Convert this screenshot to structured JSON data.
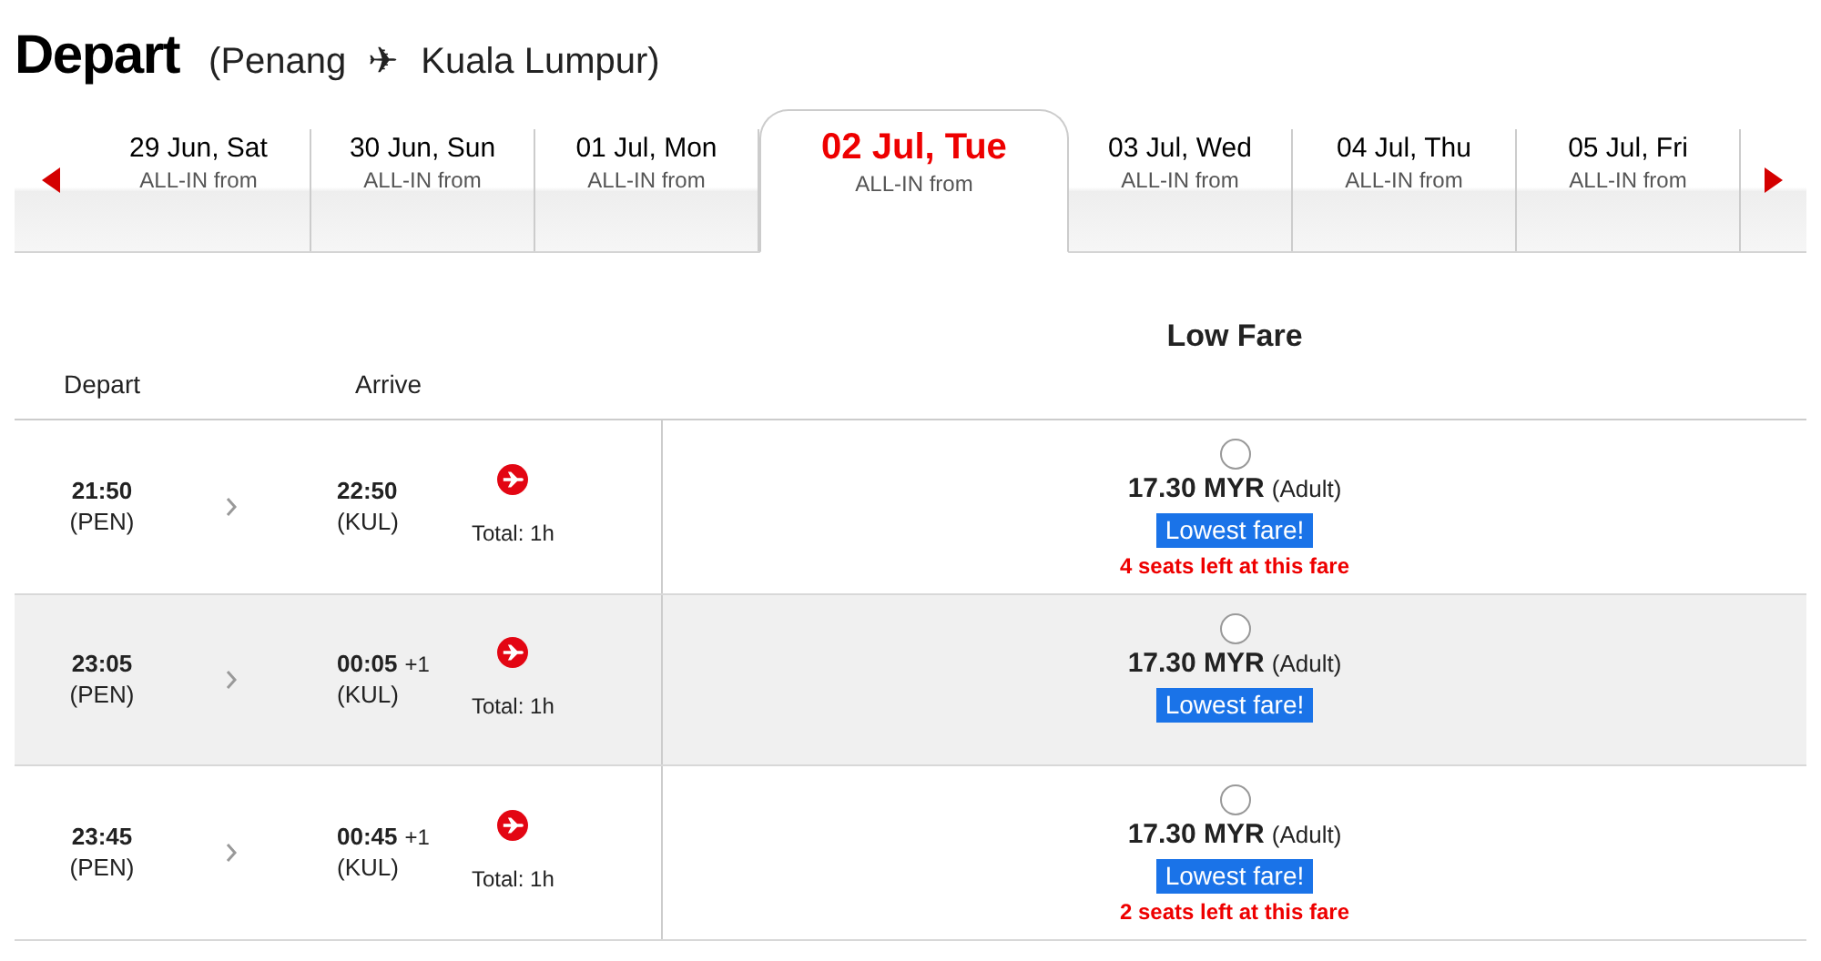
{
  "header": {
    "title": "Depart",
    "origin": "(Penang",
    "arrow": "✈",
    "destination": "Kuala Lumpur)"
  },
  "dates": [
    {
      "date": "29 Jun, Sat",
      "sub": "ALL-IN from",
      "selected": false
    },
    {
      "date": "30 Jun, Sun",
      "sub": "ALL-IN from",
      "selected": false
    },
    {
      "date": "01 Jul, Mon",
      "sub": "ALL-IN from",
      "selected": false
    },
    {
      "date": "02 Jul, Tue",
      "sub": "ALL-IN from",
      "selected": true
    },
    {
      "date": "03 Jul, Wed",
      "sub": "ALL-IN from",
      "selected": false
    },
    {
      "date": "04 Jul, Thu",
      "sub": "ALL-IN from",
      "selected": false
    },
    {
      "date": "05 Jul, Fri",
      "sub": "ALL-IN from",
      "selected": false
    }
  ],
  "columns": {
    "depart": "Depart",
    "arrive": "Arrive",
    "fare": "Low Fare"
  },
  "flights": [
    {
      "dep_time": "21:50",
      "dep_code": "(PEN)",
      "arr_time": "22:50",
      "arr_code": "(KUL)",
      "duration": "Total: 1h",
      "price": "17.30 MYR",
      "pax": "(Adult)",
      "badge": "Lowest fare!",
      "seats": "4 seats left at this fare",
      "selected": false
    },
    {
      "dep_time": "23:05",
      "dep_code": "(PEN)",
      "arr_time": "00:05",
      "arr_code": "(KUL)",
      "next_day": "+1",
      "duration": "Total: 1h",
      "price": "17.30 MYR",
      "pax": "(Adult)",
      "badge": "Lowest fare!",
      "selected": false
    },
    {
      "dep_time": "23:45",
      "dep_code": "(PEN)",
      "arr_time": "00:45",
      "arr_code": "(KUL)",
      "next_day": "+1",
      "duration": "Total: 1h",
      "price": "17.30 MYR",
      "pax": "(Adult)",
      "badge": "Lowest fare!",
      "seats": "2 seats left at this fare",
      "selected": false
    }
  ]
}
